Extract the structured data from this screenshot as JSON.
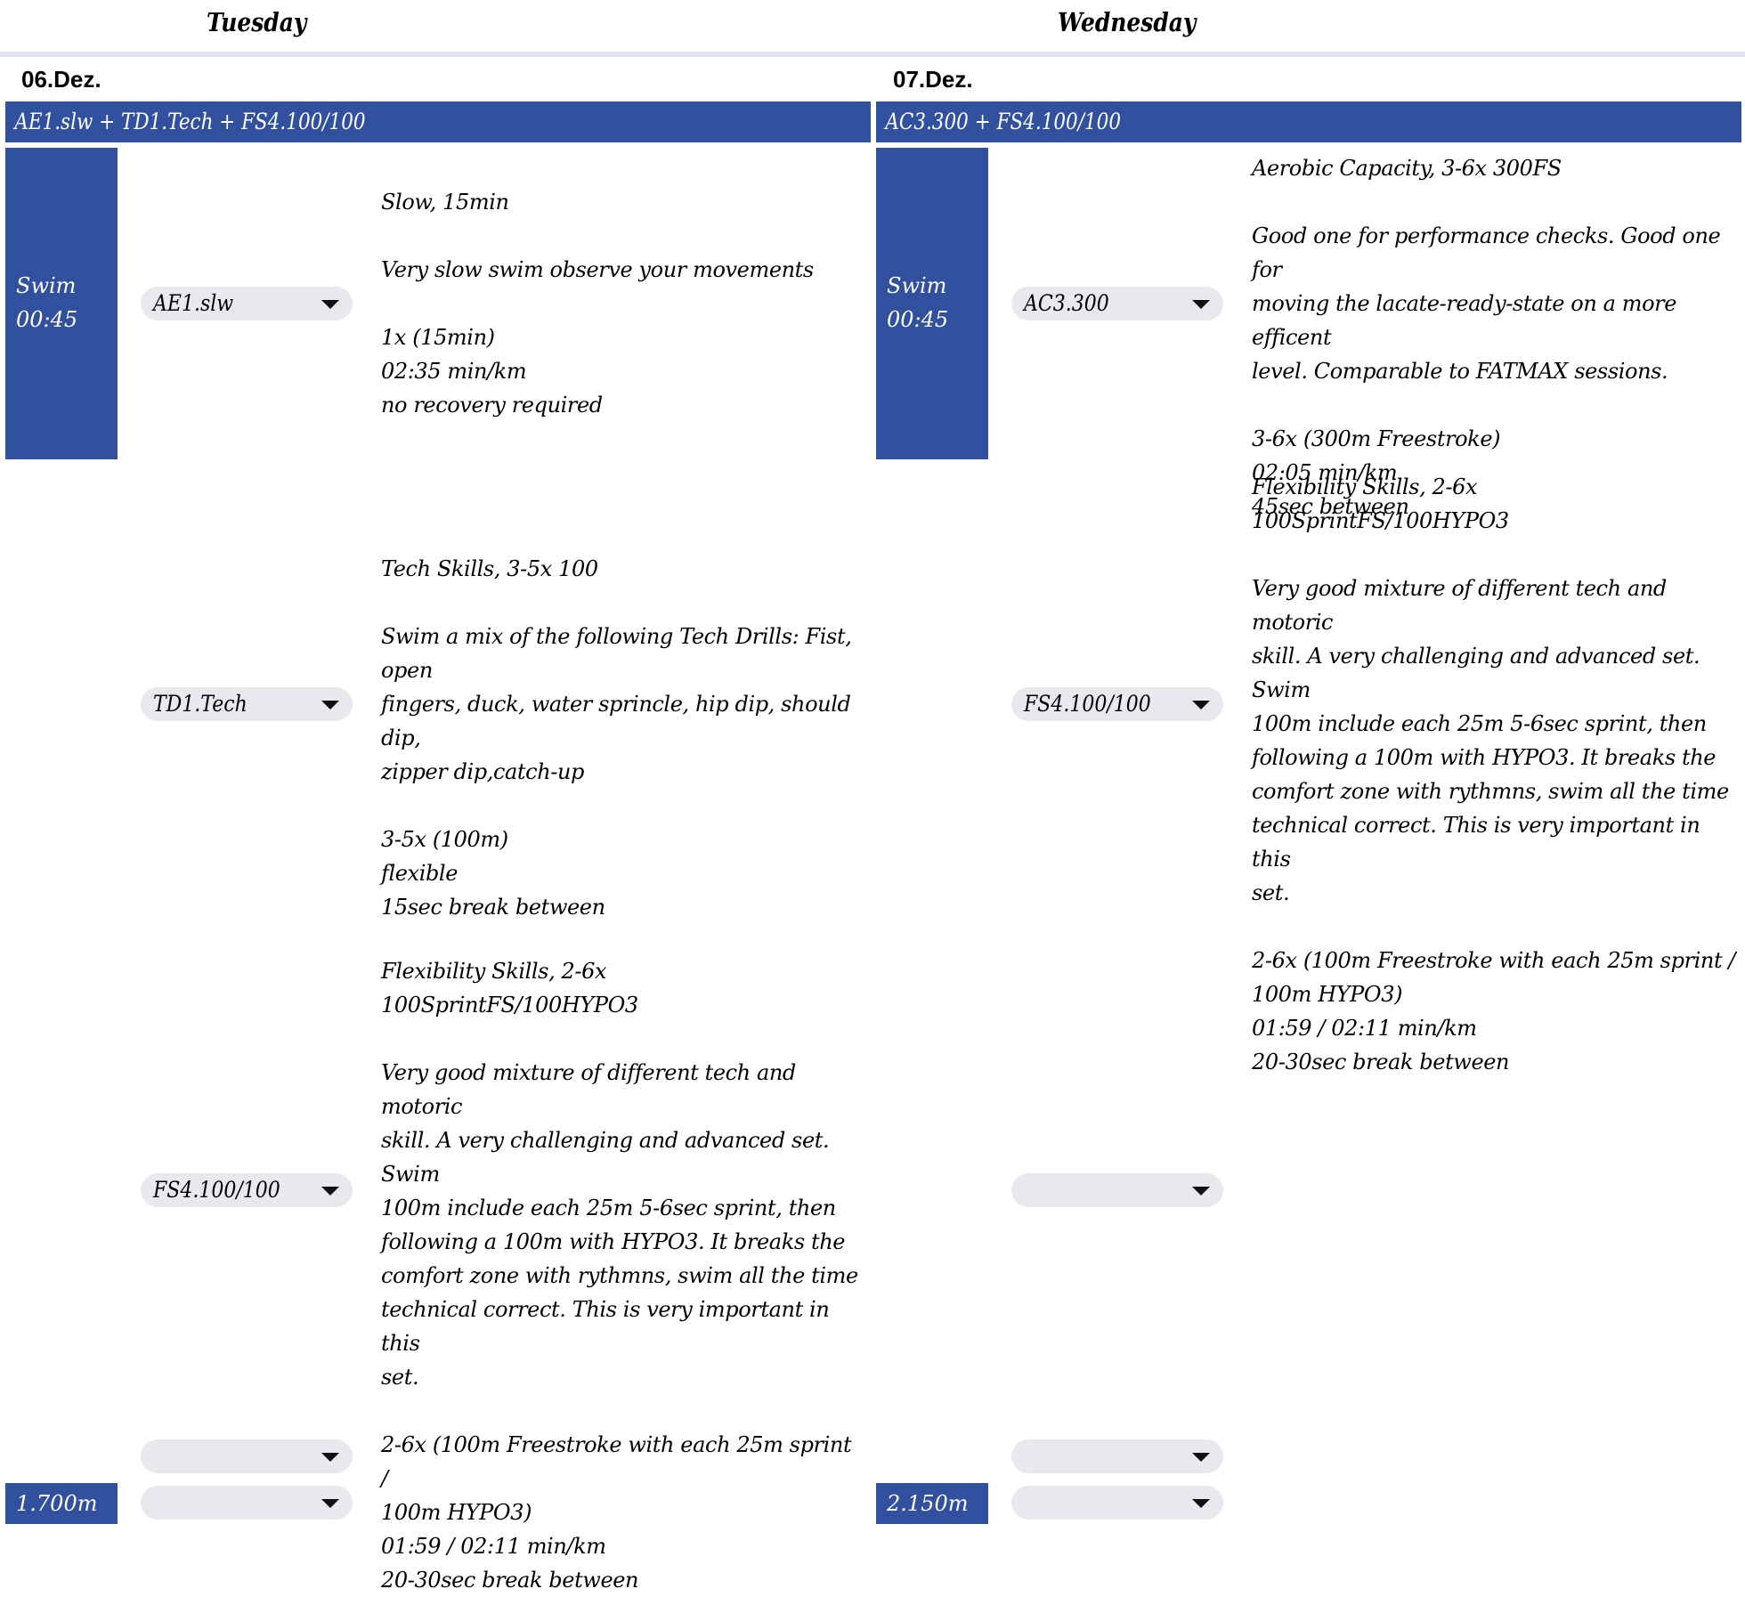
{
  "days": [
    {
      "weekday": "Tuesday",
      "date": "06.Dez.",
      "title": "AE1.slw + TD1.Tech + FS4.100/100",
      "block": {
        "label": "Swim",
        "duration": "00:45"
      },
      "distance": "1.700m",
      "sessions": [
        {
          "select": "AE1.slw",
          "desc": "Slow, 15min\n\nVery slow swim observe your movements\n\n1x (15min)\n02:35 min/km\nno recovery required"
        },
        {
          "select": "TD1.Tech",
          "desc": "Tech Skills, 3-5x 100\n\nSwim a mix of the following Tech Drills: Fist, open\nfingers, duck, water sprincle, hip dip, should dip,\nzipper dip,catch-up\n\n3-5x (100m)\nflexible\n15sec break between"
        },
        {
          "select": "FS4.100/100",
          "desc": "Flexibility Skills, 2-6x 100SprintFS/100HYPO3\n\nVery good mixture of different tech and motoric\nskill. A very challenging and advanced set. Swim\n100m include each 25m 5-6sec sprint, then\nfollowing a 100m with HYPO3. It breaks the\ncomfort zone with rythmns, swim all the time\ntechnical correct. This is very important in this\nset.\n\n2-6x (100m Freestroke with each 25m sprint /\n100m HYPO3)\n01:59 / 02:11 min/km\n20-30sec break between"
        },
        {
          "select": "",
          "desc": ""
        },
        {
          "select": "",
          "desc": ""
        }
      ]
    },
    {
      "weekday": "Wednesday",
      "date": "07.Dez.",
      "title": "AC3.300 + FS4.100/100",
      "block": {
        "label": "Swim",
        "duration": "00:45"
      },
      "distance": "2.150m",
      "sessions": [
        {
          "select": "AC3.300",
          "desc": "Aerobic Capacity, 3-6x 300FS\n\nGood one for performance checks. Good one for\nmoving the lacate-ready-state on a more efficent\nlevel. Comparable to FATMAX sessions.\n\n3-6x (300m Freestroke)\n02:05 min/km\n45sec between"
        },
        {
          "select": "FS4.100/100",
          "desc": "Flexibility Skills, 2-6x 100SprintFS/100HYPO3\n\nVery good mixture of different tech and motoric\nskill. A very challenging and advanced set. Swim\n100m include each 25m 5-6sec sprint, then\nfollowing a 100m with HYPO3. It breaks the\ncomfort zone with rythmns, swim all the time\ntechnical correct. This is very important in this\nset.\n\n2-6x (100m Freestroke with each 25m sprint /\n100m HYPO3)\n01:59 / 02:11 min/km\n20-30sec break between"
        },
        {
          "select": "",
          "desc": ""
        },
        {
          "select": "",
          "desc": ""
        },
        {
          "select": "",
          "desc": ""
        }
      ]
    }
  ],
  "icons": {
    "dropdown": "chevron-down-icon"
  },
  "colors": {
    "accent": "#31519e",
    "select_bg": "#e8e9ed",
    "rule": "#dfe3ec"
  }
}
